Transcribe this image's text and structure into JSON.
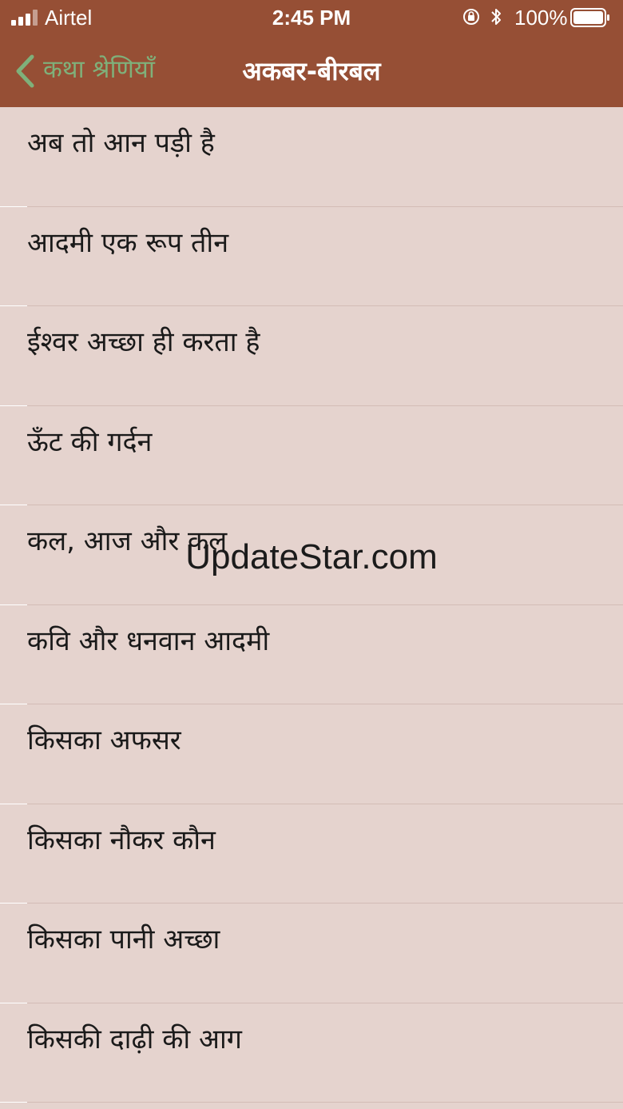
{
  "status_bar": {
    "carrier": "Airtel",
    "time": "2:45 PM",
    "battery_percent": "100%",
    "signal_strength": 3,
    "signal_max": 4
  },
  "nav": {
    "back_label": "कथा श्रेणियाँ",
    "title": "अकबर-बीरबल"
  },
  "stories": [
    "अब तो आन पड़ी है",
    "आदमी एक रूप तीन",
    "ईश्वर अच्छा ही करता है",
    "ऊँट की गर्दन",
    "कल, आज और कल",
    "कवि और धनवान आदमी",
    "किसका अफसर",
    "किसका नौकर कौन",
    "किसका पानी अच्छा",
    "किसकी दाढ़ी की आग"
  ],
  "watermark": "UpdateStar.com",
  "colors": {
    "nav_bar": "#964f35",
    "background": "#e5d3ce",
    "back_accent": "#7fb07a"
  }
}
